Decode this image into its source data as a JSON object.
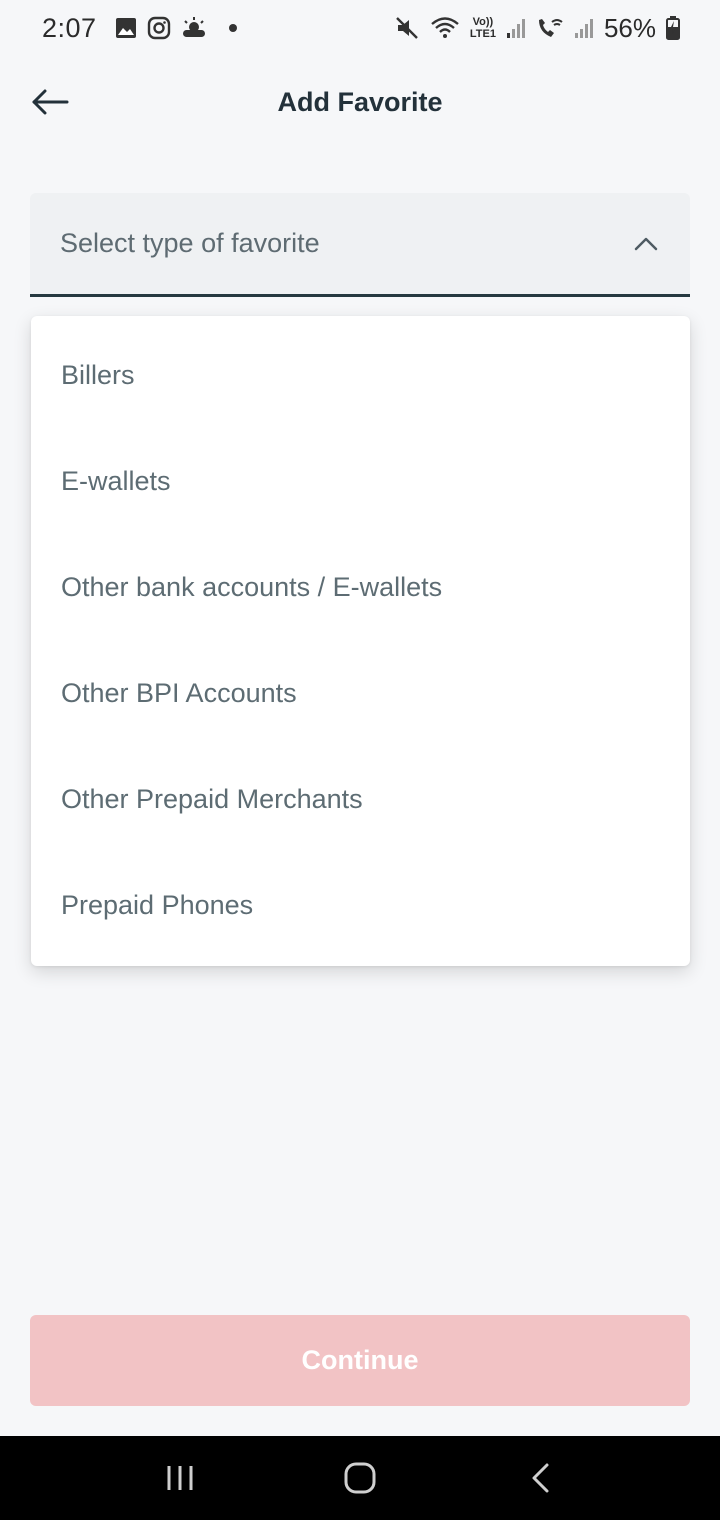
{
  "status_bar": {
    "time": "2:07",
    "left_icons": [
      "gallery-icon",
      "instagram-icon",
      "weather-icon",
      "notification-dot"
    ],
    "right_icons": [
      "mute-icon",
      "wifi-icon",
      "volte-lte-icon",
      "signal-icon",
      "wifi-calling-icon",
      "signal-2-icon"
    ],
    "network_label_top": "Vo))",
    "network_label_bottom": "LTE1",
    "battery_percent": "56%"
  },
  "header": {
    "title": "Add Favorite"
  },
  "select": {
    "placeholder": "Select type of favorite",
    "expanded": true
  },
  "menu": {
    "items": [
      {
        "label": "Billers"
      },
      {
        "label": "E-wallets"
      },
      {
        "label": "Other bank accounts / E-wallets"
      },
      {
        "label": "Other BPI Accounts"
      },
      {
        "label": "Other Prepaid Merchants"
      },
      {
        "label": "Prepaid Phones"
      }
    ]
  },
  "footer": {
    "continue_label": "Continue",
    "continue_enabled": false
  },
  "colors": {
    "background": "#f6f7f9",
    "accent_disabled": "#f2c3c5",
    "select_underline": "#263940",
    "text_primary": "#23313a",
    "text_secondary": "#5d6c73"
  }
}
